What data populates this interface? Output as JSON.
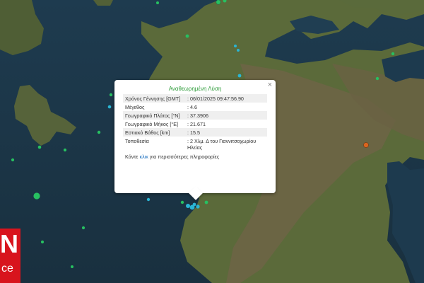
{
  "popup": {
    "title": "Αναθεωρημένη Λύση",
    "close_label": "×",
    "rows": [
      {
        "label": "Χρόνος Γέννησης [GMT]",
        "value": ": 06/01/2025 09:47:56.90"
      },
      {
        "label": "Μέγεθος",
        "value": ": 4.6"
      },
      {
        "label": "Γεωγραφικό Πλάτος [°N]",
        "value": ": 37.3906"
      },
      {
        "label": "Γεωγραφικό Μήκος [°E]",
        "value": ": 21.671"
      },
      {
        "label": "Εστιακό Βάθος [km]",
        "value": ": 15.5"
      },
      {
        "label": "Τοποθεσία",
        "value": ": 2 Χλμ. Δ του Γιαννιτσοχωρίου Ηλείας"
      }
    ],
    "more_prefix": "Κάντε ",
    "more_link": "κλικ",
    "more_suffix": " για περισσότερες πληροφορίες"
  },
  "logo": {
    "line1": "N",
    "line2": "ce"
  },
  "colors": {
    "sea": "#1c3547",
    "land": "#5a6b3a",
    "mountain": "#6f6447",
    "quake_green": "#27c061",
    "quake_cyan": "#2ab6d4",
    "quake_orange": "#d9651f",
    "logo_red": "#d8141d",
    "title_green": "#2e9c3a",
    "link_blue": "#1c6fbf"
  }
}
